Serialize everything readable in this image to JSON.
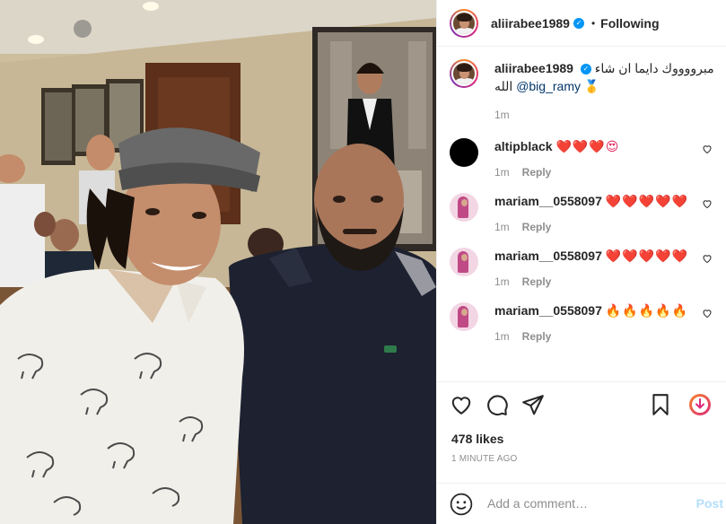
{
  "post": {
    "username": "aliirabee1989",
    "follow_status": "Following",
    "separator": "•"
  },
  "caption": {
    "username": "aliirabee1989",
    "text": "مبرووووك دايما ان شاء الله",
    "mention": "@big_ramy",
    "emoji": "🥇",
    "time": "1m"
  },
  "comments": [
    {
      "username": "altipblack",
      "text": "❤️❤️❤️😍",
      "time": "1m",
      "reply": "Reply",
      "avatar": "black"
    },
    {
      "username": "mariam__0558097",
      "text": "❤️❤️❤️❤️❤️",
      "time": "1m",
      "reply": "Reply",
      "avatar": "pink"
    },
    {
      "username": "mariam__0558097",
      "text": "❤️❤️❤️❤️❤️",
      "time": "1m",
      "reply": "Reply",
      "avatar": "pink"
    },
    {
      "username": "mariam__0558097",
      "text": "🔥🔥🔥🔥🔥",
      "time": "1m",
      "reply": "Reply",
      "avatar": "pink"
    }
  ],
  "actions": {
    "icons": [
      "heart-icon",
      "comment-icon",
      "share-icon",
      "bookmark-icon",
      "save-to-app-icon"
    ],
    "likes": "478 likes",
    "timestamp": "1 MINUTE AGO"
  },
  "add_comment": {
    "placeholder": "Add a comment…",
    "post_label": "Post"
  },
  "colors": {
    "link_blue": "#00376b",
    "verified_blue": "#0095f6",
    "post_disabled": "#b2dffc",
    "muted": "#8e8e8e"
  }
}
